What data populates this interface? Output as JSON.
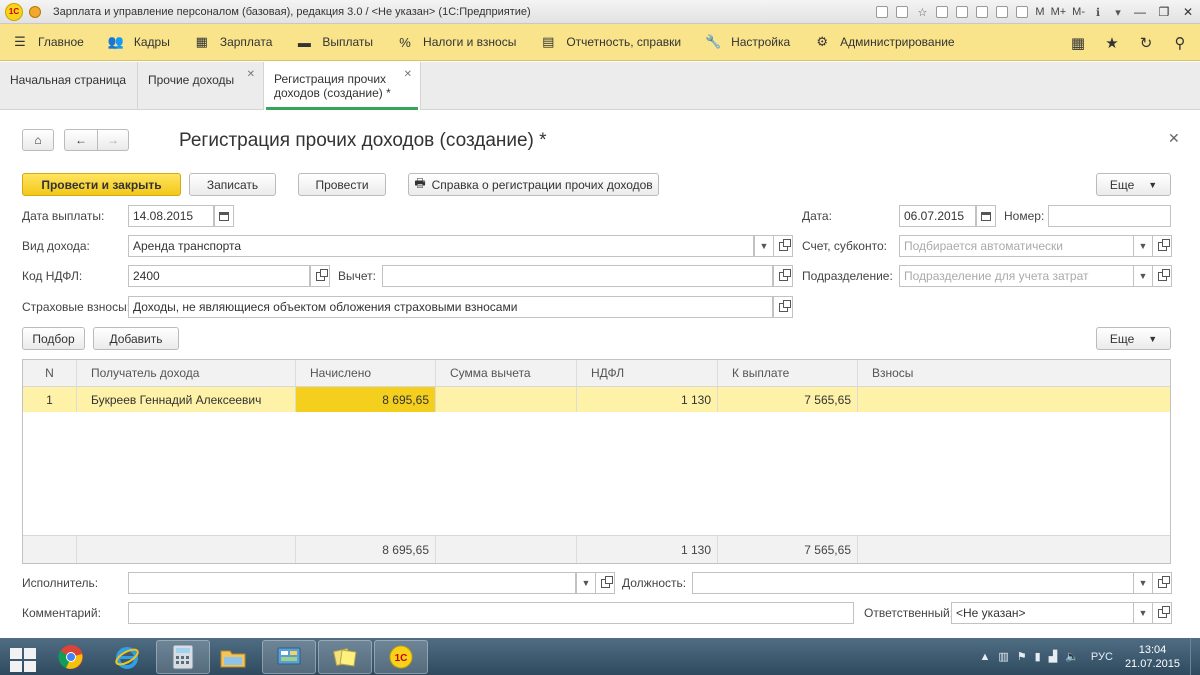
{
  "window": {
    "title": "Зарплата и управление персоналом (базовая), редакция 3.0 / <Не указан>  (1С:Предприятие)",
    "m_labels": [
      "M",
      "M+",
      "M-"
    ]
  },
  "menu": {
    "items": [
      {
        "label": "Главное",
        "icon": "hamburger-icon"
      },
      {
        "label": "Кадры",
        "icon": "people-icon"
      },
      {
        "label": "Зарплата",
        "icon": "calculator-icon"
      },
      {
        "label": "Выплаты",
        "icon": "wallet-icon"
      },
      {
        "label": "Налоги и взносы",
        "icon": "percent-icon"
      },
      {
        "label": "Отчетность, справки",
        "icon": "report-icon"
      },
      {
        "label": "Настройка",
        "icon": "wrench-icon"
      },
      {
        "label": "Администрирование",
        "icon": "gear-icon"
      }
    ]
  },
  "tabs": [
    {
      "label": "Начальная страница"
    },
    {
      "label": "Прочие доходы"
    },
    {
      "label": "Регистрация прочих доходов (создание) *"
    }
  ],
  "form": {
    "title": "Регистрация прочих доходов (создание) *",
    "buttons": {
      "post_close": "Провести и закрыть",
      "save": "Записать",
      "post": "Провести",
      "certificate": "Справка о регистрации прочих доходов",
      "more": "Еще",
      "pick": "Подбор",
      "add": "Добавить"
    },
    "fields": {
      "payment_date_label": "Дата выплаты:",
      "payment_date": "14.08.2015",
      "income_type_label": "Вид дохода:",
      "income_type": "Аренда транспорта",
      "ndfl_code_label": "Код НДФЛ:",
      "ndfl_code": "2400",
      "deduction_label": "Вычет:",
      "deduction": "",
      "insurance_label": "Страховые взносы:",
      "insurance": "Доходы, не являющиеся объектом обложения страховыми взносами",
      "date_label": "Дата:",
      "date": "06.07.2015",
      "number_label": "Номер:",
      "number": "",
      "account_label": "Счет, субконто:",
      "account_placeholder": "Подбирается автоматически",
      "department_label": "Подразделение:",
      "department_placeholder": "Подразделение для учета затрат",
      "executor_label": "Исполнитель:",
      "executor": "",
      "position_label": "Должность:",
      "position": "",
      "comment_label": "Комментарий:",
      "comment": "",
      "responsible_label": "Ответственный:",
      "responsible": "<Не указан>"
    }
  },
  "table": {
    "columns": [
      "N",
      "Получатель дохода",
      "Начислено",
      "Сумма вычета",
      "НДФЛ",
      "К выплате",
      "Взносы"
    ],
    "rows": [
      {
        "n": "1",
        "recipient": "Букреев Геннадий Алексеевич",
        "accrued": "8 695,65",
        "deduction": "",
        "ndfl": "1 130",
        "payout": "7 565,65",
        "contributions": ""
      }
    ],
    "totals": {
      "accrued": "8 695,65",
      "ndfl": "1 130",
      "payout": "7 565,65"
    }
  },
  "taskbar": {
    "apps": [
      "chrome-icon",
      "ie-icon",
      "calculator-icon",
      "explorer-icon",
      "control-panel-icon",
      "sticky-notes-icon",
      "1c-icon"
    ],
    "language": "РУС",
    "time": "13:04",
    "date": "21.07.2015"
  },
  "colors": {
    "menu_bg": "#f9e48c",
    "primary_button": "#f5cf1e",
    "selected_row": "#fdf2a7",
    "active_tab_underline": "#38a35a"
  }
}
